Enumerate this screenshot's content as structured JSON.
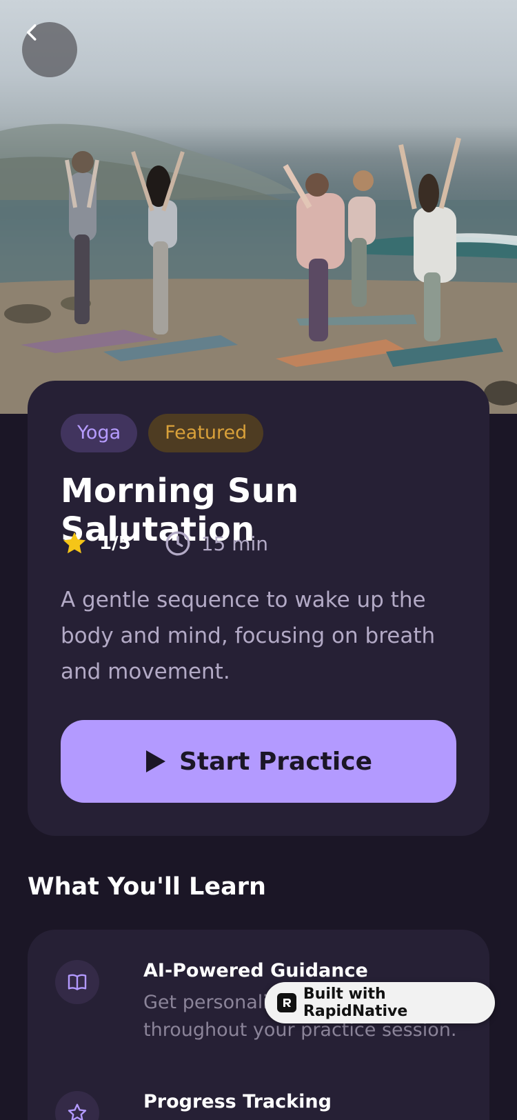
{
  "hero": {
    "image_alt": "Group of women doing tree pose yoga on a beach"
  },
  "header": {
    "back_icon": "chevron-left-icon"
  },
  "course": {
    "tags": [
      "Yoga",
      "Featured"
    ],
    "title": "Morning Sun Salutation",
    "rating": "1/5",
    "duration": "15 min",
    "description": "A gentle sequence to wake up the body and mind, focusing on breath and movement.",
    "start_label": "Start Practice"
  },
  "learn": {
    "title": "What You'll Learn",
    "features": [
      {
        "icon": "book-icon",
        "title": "AI-Powered Guidance",
        "description": "Get personalized suggestions throughout your practice session."
      },
      {
        "icon": "star-outline-icon",
        "title": "Progress Tracking",
        "description": ""
      }
    ]
  },
  "badge": {
    "label": "Built with RapidNative"
  },
  "colors": {
    "background": "#1b1626",
    "card": "#262035",
    "accent": "#b39aff",
    "star": "#f5c518",
    "featured_text": "#d9a13a"
  }
}
